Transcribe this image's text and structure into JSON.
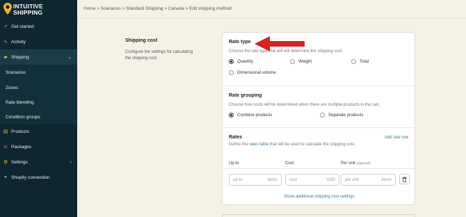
{
  "app": {
    "brand_line1": "INTUITIVE",
    "brand_line2": "SHIPPING"
  },
  "sidebar": {
    "items": [
      {
        "label": "Get started",
        "icon": "rocket-icon"
      },
      {
        "label": "Activity",
        "icon": "pulse-icon"
      },
      {
        "label": "Shipping",
        "icon": "truck-icon",
        "expanded": true
      },
      {
        "label": "Scenarios",
        "sub": true
      },
      {
        "label": "Zones",
        "sub": true
      },
      {
        "label": "Rate blending",
        "sub": true
      },
      {
        "label": "Condition groups",
        "sub": true
      },
      {
        "label": "Products",
        "icon": "box-icon"
      },
      {
        "label": "Packages",
        "icon": "package-icon"
      },
      {
        "label": "Settings",
        "icon": "gear-icon"
      },
      {
        "label": "Shopify connection",
        "icon": "link-icon"
      }
    ]
  },
  "breadcrumb": {
    "text": "Home > Scenarios > Standard Shipping > Canada > Edit shipping method"
  },
  "shipping_cost": {
    "heading": "Shipping cost",
    "description_line1": "Configure the settings for calculating",
    "description_line2": "the shipping cost."
  },
  "rate_type": {
    "title": "Rate type",
    "description": "Choose the rate type that will will determine the shipping cost.",
    "options": [
      {
        "label": "Quantity",
        "selected": true
      },
      {
        "label": "Weight",
        "selected": false
      },
      {
        "label": "Total",
        "selected": false
      },
      {
        "label": "Dimensional volume",
        "selected": false
      }
    ]
  },
  "rate_grouping": {
    "title": "Rate grouping",
    "description": "Choose how costs will be determined when there are multiple products in the cart.",
    "options": [
      {
        "label": "Combine products",
        "selected": true
      },
      {
        "label": "Separate products",
        "selected": false
      }
    ]
  },
  "rates": {
    "title": "Rates",
    "description_pre": "Define the ",
    "description_link": "rates table",
    "description_post": " that will be used to calculate the shipping cost.",
    "add_rate": "Add rate row",
    "col_upto": "Up to",
    "col_cost": "Cost",
    "col_perunit": "Per unit",
    "col_optional": "(Optional)",
    "row": {
      "upto_placeholder": "up to",
      "upto_unit": "items",
      "cost_placeholder": "cost",
      "cost_unit": "USD",
      "perunit_placeholder": "per unit",
      "perunit_unit": "items"
    },
    "show_more": "Show additional shipping cost settings"
  },
  "colors": {
    "sidebar": "#0f2630",
    "accent": "#f0b429",
    "link": "#2a7f97",
    "arrow": "#e11d1d"
  }
}
